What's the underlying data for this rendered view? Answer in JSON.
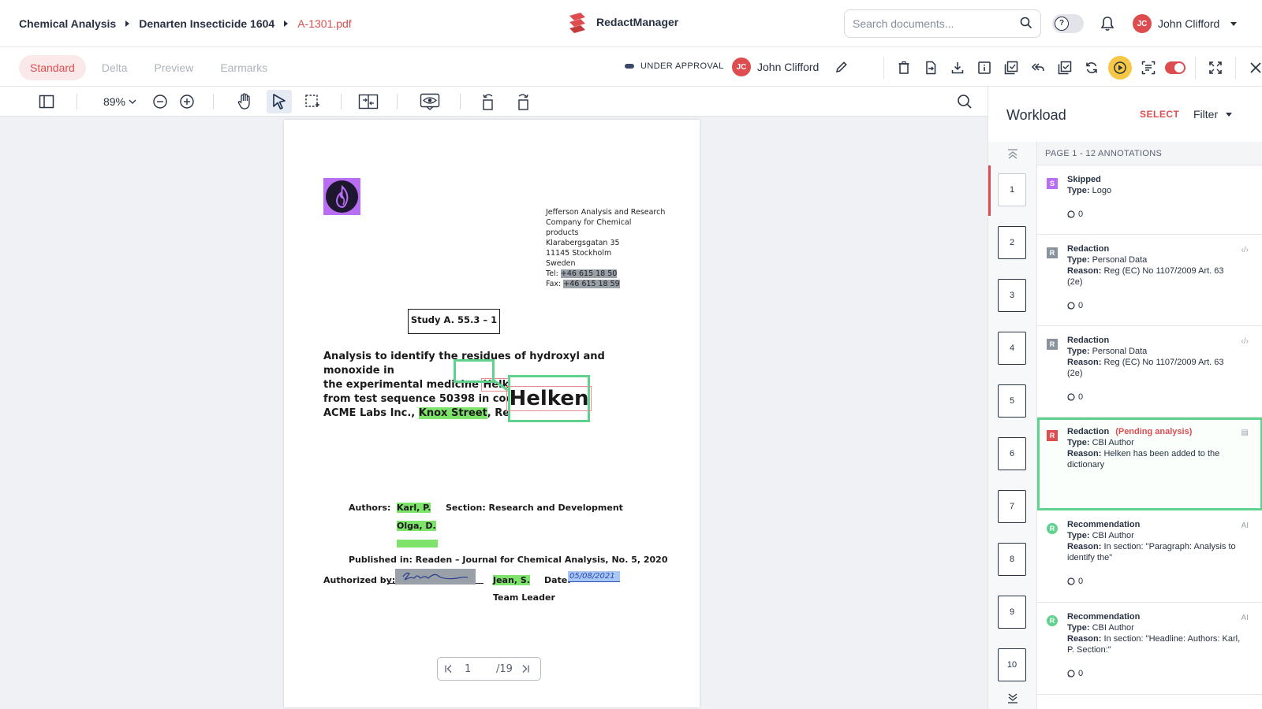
{
  "breadcrumb": {
    "items": [
      "Chemical Analysis",
      "Denarten Insecticide 1604"
    ],
    "current": "A-1301.pdf"
  },
  "brand": {
    "name": "RedactManager",
    "color": "#dd4d50"
  },
  "search": {
    "placeholder": "Search documents...",
    "value": ""
  },
  "user": {
    "initials": "JC",
    "name": "John Clifford"
  },
  "view_tabs": [
    "Standard",
    "Delta",
    "Preview",
    "Earmarks"
  ],
  "selected_view": "Standard",
  "status": {
    "label": "UNDER APPROVAL"
  },
  "assignee": {
    "initials": "JC",
    "name": "John Clifford"
  },
  "viewer": {
    "zoom": "89%",
    "page": "1",
    "total": "/19"
  },
  "document": {
    "address": [
      "Jefferson Analysis and Research",
      "Company for Chemical",
      "products",
      "Klarabergsgatan 35",
      "11145 Stockholm",
      "Sweden"
    ],
    "tel_label": "Tel:",
    "tel": "+46 615 18 50",
    "fax_label": "Fax:",
    "fax": "+46 615 18 59",
    "study": "Study A. 55.3 – 1",
    "title_l1": "Analysis to identify the residues of hydroxyl and monoxide in",
    "title_l2a": "the experimental medicine ",
    "helken": "Helken",
    "title_l3": "from test sequence 50398 in cooperati",
    "title_l4a": "ACME Labs Inc., ",
    "knox": "Knox Street",
    "title_l4b": ", Redcliff 1",
    "magnified": "Helken",
    "authors_label": "Authors:",
    "author1": "Karl, P.",
    "author2": "Olga, D.",
    "section": "Section: Research and Development",
    "published": "Published in: Readen – Journal for Chemical Analysis, No. 5, 2020",
    "authorized_label": "Authorized by:",
    "approver": "Jean, S.",
    "date_label": "Date:",
    "date_value": "05/08/2021",
    "team_leader": "Team Leader"
  },
  "workload": {
    "title": "Workload",
    "select_label": "SELECT",
    "filter_label": "Filter",
    "page_header": "PAGE 1 - 12 ANNOTATIONS",
    "thumbs": [
      "1",
      "2",
      "3",
      "4",
      "5",
      "6",
      "7",
      "8",
      "9",
      "10"
    ],
    "annotations": [
      {
        "badge": "S",
        "title": "Skipped",
        "pending": "",
        "type_label": "Type:",
        "type": "Logo",
        "reason_label": "",
        "reason": "",
        "comments": "0",
        "corner": ""
      },
      {
        "badge": "R",
        "title": "Redaction",
        "pending": "",
        "type_label": "Type:",
        "type": "Personal Data",
        "reason_label": "Reason:",
        "reason": "Reg (EC) No 1107/2009 Art. 63 (2e)",
        "comments": "0",
        "corner": "‹/›"
      },
      {
        "badge": "R",
        "title": "Redaction",
        "pending": "",
        "type_label": "Type:",
        "type": "Personal Data",
        "reason_label": "Reason:",
        "reason": "Reg (EC) No 1107/2009 Art. 63 (2e)",
        "comments": "0",
        "corner": "‹/›"
      },
      {
        "badge": "R",
        "title": "Redaction",
        "pending": "(Pending analysis)",
        "type_label": "Type:",
        "type": "CBI Author",
        "reason_label": "Reason:",
        "reason": "Helken has been added to the dictionary",
        "comments": "",
        "corner": "▤"
      },
      {
        "badge": "R",
        "title": "Recommendation",
        "pending": "",
        "type_label": "Type:",
        "type": "CBI Author",
        "reason_label": "Reason:",
        "reason": "In section: \"Paragraph: Analysis to identify the\"",
        "comments": "0",
        "corner": "AI"
      },
      {
        "badge": "R",
        "title": "Recommendation",
        "pending": "",
        "type_label": "Type:",
        "type": "CBI Author",
        "reason_label": "Reason:",
        "reason": "In section: \"Headline: Authors: Karl, P. Section:\"",
        "comments": "0",
        "corner": "AI"
      }
    ]
  }
}
